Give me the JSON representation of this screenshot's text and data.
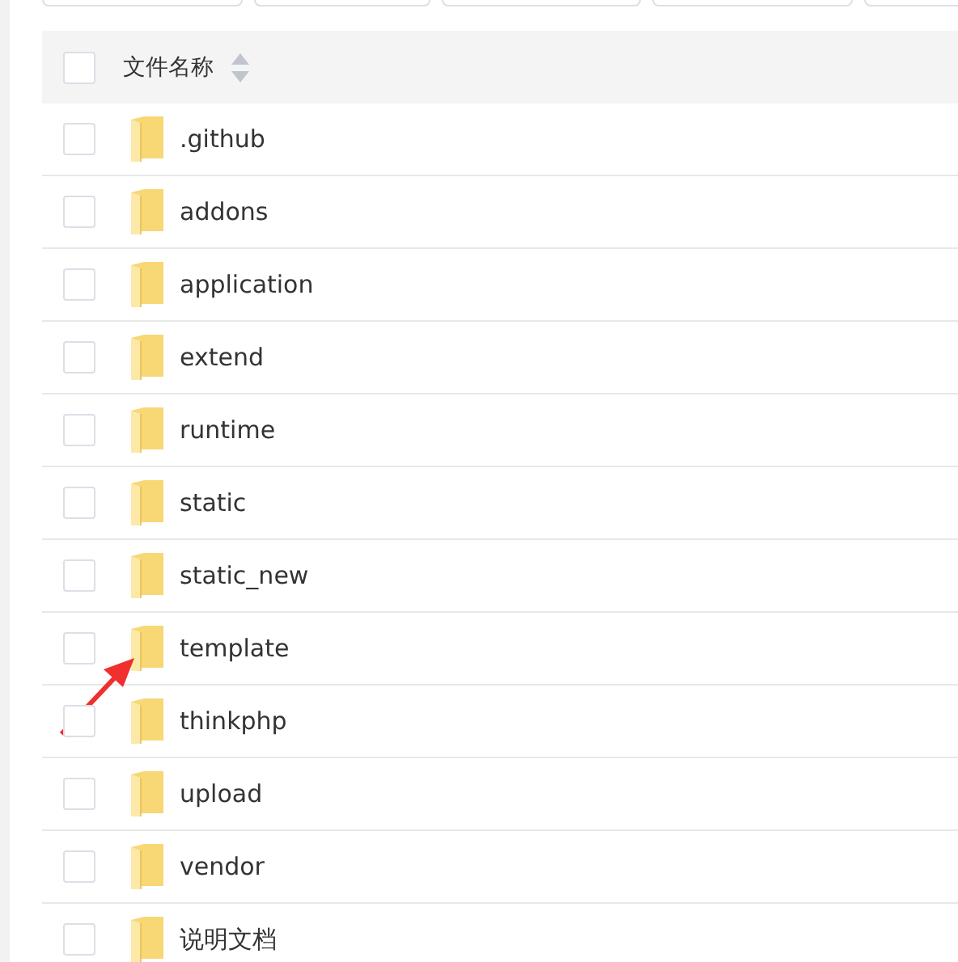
{
  "table": {
    "columns": [
      {
        "label": "文件名称"
      }
    ],
    "rows": [
      {
        "name": ".github",
        "checked": false
      },
      {
        "name": "addons",
        "checked": false
      },
      {
        "name": "application",
        "checked": false
      },
      {
        "name": "extend",
        "checked": false
      },
      {
        "name": "runtime",
        "checked": false
      },
      {
        "name": "static",
        "checked": false
      },
      {
        "name": "static_new",
        "checked": false
      },
      {
        "name": "template",
        "checked": false
      },
      {
        "name": "thinkphp",
        "checked": false
      },
      {
        "name": "upload",
        "checked": false
      },
      {
        "name": "vendor",
        "checked": false
      },
      {
        "name": "说明文档",
        "checked": false
      }
    ]
  },
  "header_checkbox": {
    "checked": false
  }
}
